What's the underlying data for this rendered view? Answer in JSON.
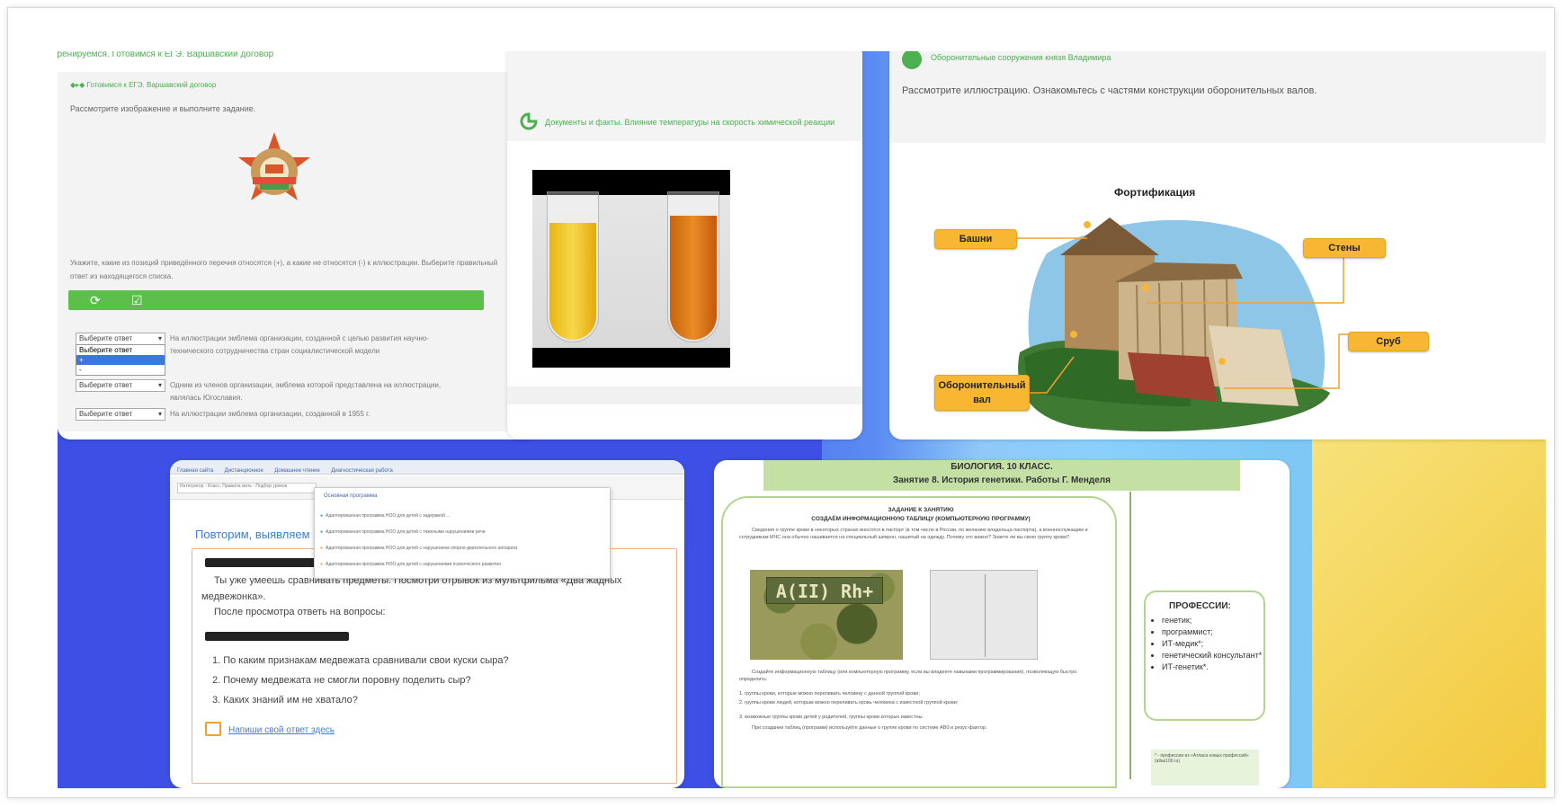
{
  "card1": {
    "title": "Тренируемся. Готовимся к ЕГЭ. Варшавский договор",
    "crumb": "Готовимся к ЕГЭ. Варшавский договор",
    "instruction": "Рассмотрите изображение и выполните задание.",
    "question": "Укажите, какие из позиций приведённого перечня относятся (+), а какие не относятся (-) к иллюстрации. Выберите правильный ответ из находящегося списка.",
    "select_label": "Выберите ответ",
    "dropdown_options": [
      "Выберите ответ",
      "+",
      "-"
    ],
    "rows": [
      "На иллюстрации эмблема организации, созданной с целью развития научно-технического сотрудничества стран социалистической модели",
      "Одним из членов организации, эмблема которой представлена на иллюстрации, являлась Югославия.",
      "На иллюстрации эмблема организации, созданной в 1955 г."
    ],
    "colors": {
      "green": "#5cbf4c"
    }
  },
  "card2": {
    "title": "Документы и факты. Влияние температуры на скорость химической реакции",
    "tube_colors": [
      "#f2c417",
      "#e0801a"
    ]
  },
  "card3": {
    "title": "Оборонительные сооружения князя Владимира",
    "instruction": "Рассмотрите иллюстрацию. Ознакомьтесь с частями конструкции оборонительных валов.",
    "figure_title": "Фортификация",
    "labels": {
      "towers": "Башни",
      "walls": "Стены",
      "frame": "Сруб",
      "rampart": "Оборонительный вал"
    }
  },
  "card4": {
    "tabs": [
      "Главная сайта",
      "Дистанционное",
      "Домашнее чтение",
      "Диагностическая работа"
    ],
    "search_value": "Интегратор - Класс, Правила мать - Подбор уроков",
    "dropdown_header": "Основная программа",
    "dropdown_items": [
      "Адаптированная программа НОО для детей с задержкой ...",
      "Адаптированная программа НОО для детей с тяжелыми нарушениями речи",
      "Адаптированная программа НОО для детей с нарушением опорно-двигательного аппарата",
      "Адаптированная программа НОО для детей с нарушениями психического развития"
    ],
    "heading": "Повторим, выявляем затруднения",
    "para1": "Ты уже умеешь сравнивать предметы. Посмотри отрывок из мультфильма «Два жадных медвежонка».",
    "para2": "После просмотра ответь на вопросы:",
    "questions": [
      "1. По каким признакам медвежата сравнивали свои куски сыра?",
      "2. Почему медвежата не смогли поровну поделить сыр?",
      "3. Каких знаний им не хватало?"
    ],
    "link": "Напиши свой ответ здесь"
  },
  "card5": {
    "bar_line1": "БИОЛОГИЯ. 10 КЛАСС.",
    "bar_line2": "Занятие 8. История генетики. Работы Г. Менделя",
    "doc_title1": "ЗАДАНИЕ К ЗАНЯТИЮ",
    "doc_title2": "СОЗДАЁМ ИНФОРМАЦИОННУЮ ТАБЛИЦУ (КОМПЬЮТЕРНУЮ ПРОГРАММУ)",
    "doc_para1": "Сведения о группе крови в некоторых странах вносятся в паспорт (в том числе в России, по желанию владельца паспорта), а военнослужащим и сотрудникам МЧС она обычно нашивается на специальный шеврон, нашитый на одежду. Почему это важно? Знаете ли вы свою группу крови?",
    "patch_text": "A(II) Rh+",
    "doc_para2": "Создайте информационную таблицу (или компьютерную программу, если вы владеете навыками программирования), позволяющую быстро определить:",
    "doc_list": [
      "1. группы крови, которые можно переливать человеку с данной группой крови;",
      "2. группы крови людей, которым можно переливать кровь человека с известной группой крови;",
      "3. возможные группы крови детей у родителей, группы крови которых известны."
    ],
    "doc_para3": "При создании таблиц (программ) используйте данные о группе крови по системе AB0 и резус-фактор.",
    "prof_title": "ПРОФЕССИИ:",
    "professions": [
      "генетик;",
      "программист;",
      "ИТ-медик*;",
      "генетический консультант*",
      "ИТ-генетик*."
    ],
    "note": "* - профессии из «Атласа новых профессий» (atlas100.ru)"
  }
}
